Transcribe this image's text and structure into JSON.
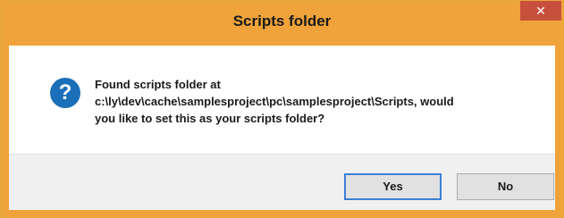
{
  "dialog": {
    "title": "Scripts folder",
    "close_glyph": "✕",
    "icon": "question-icon",
    "icon_glyph": "?",
    "message_lines": [
      "Found scripts folder at",
      "c:\\ly\\dev\\cache\\samplesproject\\pc\\samplesproject\\Scripts, would",
      "you like to set this as your scripts folder?"
    ],
    "yes_label": "Yes",
    "no_label": "No"
  },
  "colors": {
    "titlebar": "#f0a33a",
    "close_button": "#c7503d",
    "icon_blue": "#1a6fb8",
    "default_button_border": "#3c7fd8",
    "button_bar": "#f0f0f0"
  }
}
